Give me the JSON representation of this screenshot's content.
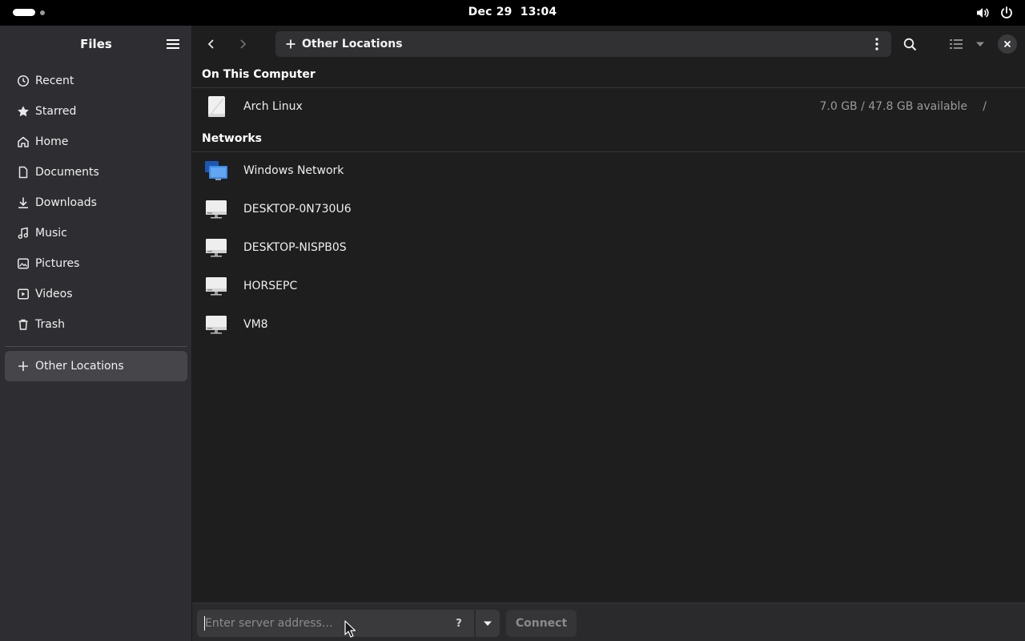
{
  "topbar": {
    "date": "Dec 29",
    "time": "13:04",
    "icons": [
      "volume-icon",
      "power-icon"
    ]
  },
  "sidebar": {
    "title": "Files",
    "items": [
      {
        "label": "Recent",
        "icon": "clock-icon"
      },
      {
        "label": "Starred",
        "icon": "star-icon"
      },
      {
        "label": "Home",
        "icon": "home-icon"
      },
      {
        "label": "Documents",
        "icon": "document-icon"
      },
      {
        "label": "Downloads",
        "icon": "download-icon"
      },
      {
        "label": "Music",
        "icon": "music-icon"
      },
      {
        "label": "Pictures",
        "icon": "picture-icon"
      },
      {
        "label": "Videos",
        "icon": "video-icon"
      },
      {
        "label": "Trash",
        "icon": "trash-icon"
      }
    ],
    "other_locations": "Other Locations"
  },
  "header": {
    "path_label": "Other Locations"
  },
  "content": {
    "on_this_computer": {
      "title": "On This Computer",
      "items": [
        {
          "name": "Arch Linux",
          "space": "7.0 GB / 47.8 GB available",
          "path": "/"
        }
      ]
    },
    "networks": {
      "title": "Networks",
      "items": [
        {
          "name": "Windows Network",
          "icon": "network-icon"
        },
        {
          "name": "DESKTOP-0N730U6",
          "icon": "computer-icon"
        },
        {
          "name": "DESKTOP-NISPB0S",
          "icon": "computer-icon"
        },
        {
          "name": "HORSEPC",
          "icon": "computer-icon"
        },
        {
          "name": "VM8",
          "icon": "computer-icon"
        }
      ]
    }
  },
  "connect_bar": {
    "placeholder": "Enter server address…",
    "help_glyph": "?",
    "connect_label": "Connect"
  },
  "colors": {
    "window_bg": "#1e1e1e",
    "sidebar_bg": "#2e2e32",
    "selected_bg": "#45454a",
    "muted_text": "#9a9a9a"
  }
}
